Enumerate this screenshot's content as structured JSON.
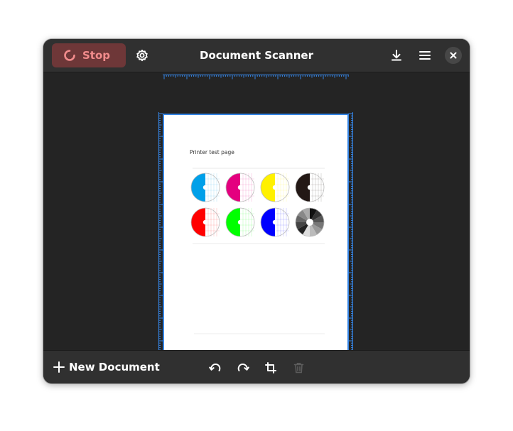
{
  "header": {
    "stop_label": "Stop",
    "title": "Document Scanner"
  },
  "page": {
    "heading": "Printer test page",
    "swatch_colors": [
      "#00a0e9",
      "#e4007f",
      "#fff100",
      "#231815",
      "#ff0000",
      "#00ff00",
      "#0000ff",
      "#808080"
    ]
  },
  "footer": {
    "new_document_label": "New Document"
  },
  "colors": {
    "window_bg": "#242424",
    "headerbar_bg": "#303030",
    "stop_bg": "#6e3738",
    "stop_fg": "#f28c8c",
    "accent": "#3584e4"
  },
  "icons": [
    "spinner-icon",
    "gear-icon",
    "download-icon",
    "menu-icon",
    "close-icon",
    "plus-icon",
    "rotate-left-icon",
    "rotate-right-icon",
    "crop-icon",
    "trash-icon"
  ]
}
